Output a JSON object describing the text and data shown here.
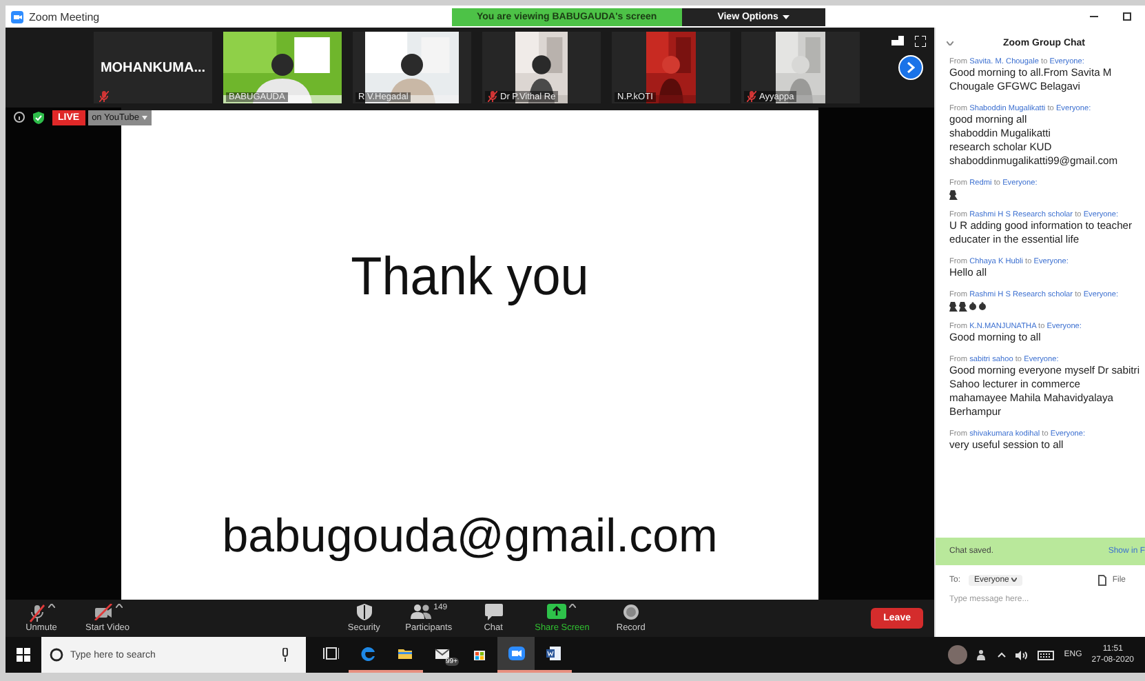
{
  "window": {
    "title": "Zoom Meeting"
  },
  "banner": {
    "text": "You are viewing BABUGAUDA's screen",
    "button": "View Options"
  },
  "gallery": {
    "name_tile": {
      "name": "MOHANKUMA...",
      "muted": true
    },
    "videos": [
      {
        "name": "BABUGAUDA",
        "muted": false
      },
      {
        "name": "R  V.Hegadal",
        "muted": false
      },
      {
        "name": "Dr P.Vithal Re",
        "muted": true
      },
      {
        "name": "N.P.kOTI",
        "muted": false
      },
      {
        "name": "Ayyappa",
        "muted": true
      }
    ]
  },
  "live": {
    "badge": "LIVE",
    "service": "on YouTube"
  },
  "slide": {
    "heading": "Thank you",
    "email": "babugouda@gmail.com"
  },
  "toolbar": {
    "buttons": [
      {
        "label": "Unmute",
        "kind": "mic_off",
        "menu": true
      },
      {
        "label": "Start Video",
        "kind": "video_off",
        "menu": true
      },
      {
        "label": "Security",
        "kind": "shield",
        "menu": false
      },
      {
        "label": "Participants",
        "kind": "people",
        "count": "149",
        "menu": false
      },
      {
        "label": "Chat",
        "kind": "chat",
        "menu": false
      },
      {
        "label": "Share Screen",
        "kind": "share",
        "menu": true
      },
      {
        "label": "Record",
        "kind": "record",
        "menu": false
      }
    ],
    "leave": "Leave"
  },
  "chat": {
    "title": "Zoom Group Chat",
    "messages": [
      {
        "from_label": "From",
        "sender": "Savita. M. Chougale",
        "to_label": "to",
        "recipient": "Everyone:",
        "lines": [
          "Good morning to all.From Savita  M Chougale GFGWC Belagavi"
        ]
      },
      {
        "from_label": "From",
        "sender": "Shaboddin Mugalikatti",
        "to_label": "to",
        "recipient": "Everyone:",
        "lines": [
          "good morning all",
          "shaboddin  Mugalikatti",
          "research scholar KUD",
          "shaboddinmugalikatti99@gmail.com"
        ]
      },
      {
        "from_label": "From",
        "sender": "Redmi",
        "to_label": "to",
        "recipient": "Everyone:",
        "emoji": [
          {
            "kind": "tall"
          }
        ]
      },
      {
        "from_label": "From",
        "sender": "Rashmi H S Research scholar",
        "to_label": "to",
        "recipient": "Everyone:",
        "lines": [
          "  U R adding good information to teacher educater in the essential life"
        ]
      },
      {
        "from_label": "From",
        "sender": "Chhaya K Hubli",
        "to_label": "to",
        "recipient": "Everyone:",
        "lines": [
          "Hello all"
        ]
      },
      {
        "from_label": "From",
        "sender": "Rashmi H S Research scholar",
        "to_label": "to",
        "recipient": "Everyone:",
        "emoji": [
          {
            "kind": "tall"
          },
          {
            "kind": "tall"
          },
          {
            "kind": "round"
          },
          {
            "kind": "round"
          }
        ]
      },
      {
        "from_label": "From",
        "sender": "K.N.MANJUNATHA",
        "to_label": "to",
        "recipient": "Everyone:",
        "lines": [
          "Good  morning  to all"
        ]
      },
      {
        "from_label": "From",
        "sender": "sabitri sahoo",
        "to_label": "to",
        "recipient": "Everyone:",
        "lines": [
          "Good morning everyone myself Dr sabitri Sahoo lecturer in commerce mahamayee Mahila  Mahavidyalaya Berhampur"
        ]
      },
      {
        "from_label": "From",
        "sender": "shivakumara kodihal",
        "to_label": "to",
        "recipient": "Everyone:",
        "lines": [
          "very useful session to all"
        ]
      }
    ],
    "notice": {
      "text": "Chat saved.",
      "link": "Show in F"
    },
    "to_label": "To:",
    "recipient": "Everyone",
    "file": "File",
    "placeholder": "Type message here..."
  },
  "taskbar": {
    "search_placeholder": "Type here to search",
    "apps": [
      {
        "kind": "taskview",
        "running": false,
        "active": false
      },
      {
        "kind": "edge",
        "running": true,
        "active": false
      },
      {
        "kind": "folder",
        "running": true,
        "active": false
      },
      {
        "kind": "mail",
        "badge": "99+",
        "running": false,
        "active": false
      },
      {
        "kind": "store",
        "running": false,
        "active": false
      },
      {
        "kind": "zoom",
        "running": true,
        "active": true
      },
      {
        "kind": "word",
        "running": true,
        "active": false
      }
    ],
    "language": "ENG",
    "time": "11:51",
    "date": "27-08-2020"
  }
}
